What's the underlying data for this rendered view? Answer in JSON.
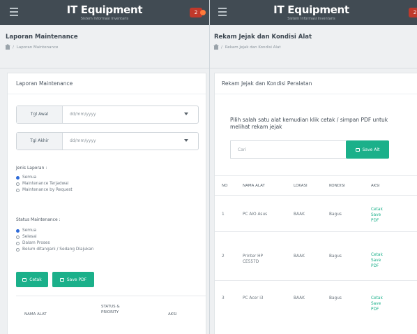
{
  "app": {
    "brand": "IT Equipment",
    "brand_sub": "Sistem Informasi Inventaris",
    "notif_count": "2"
  },
  "left": {
    "page_title": "Laporan Maintenance",
    "breadcrumb": "Laporan Maintenance",
    "card_title": "Laporan Maintenance",
    "tgl_awal_label": "Tgl Awal",
    "tgl_akhir_label": "Tgl Akhir",
    "date_placeholder": "dd/mm/yyyy",
    "jenis_label": "Jenis Laporan :",
    "jenis_options": [
      "Semua",
      "Maintenance Terjadwal",
      "Maintenance by Request"
    ],
    "status_label": "Status Maintenance :",
    "status_options": [
      "Semua",
      "Selesai",
      "Dalam Proses",
      "Belum ditangani / Sedang Diajukan"
    ],
    "btn_cetak": "Cetak",
    "btn_pdf": "Save PDF",
    "table_headers": [
      "NAMA ALAT",
      "STATUS &\nPRIORITY",
      "AKSI"
    ]
  },
  "right": {
    "page_title": "Rekam Jejak dan Kondisi Alat",
    "breadcrumb": "Rekam Jejak dan Kondisi Alat",
    "card_title": "Rekam Jejak dan Kondisi Peralatan",
    "instruction": "Pilih salah satu alat kemudian klik cetak / simpan PDF untuk melihat rekam jejak",
    "search_placeholder": "Cari",
    "btn_save": "Save Alt",
    "table_headers": [
      "NO",
      "NAMA ALAT",
      "LOKASI",
      "KONDISI",
      "AKSI"
    ],
    "rows": [
      {
        "no": "1",
        "nama": "PC AIO Asus",
        "lokasi": "BAAK",
        "kondisi": "Bagus",
        "aksi": [
          "Cetak",
          "Save",
          "PDF"
        ]
      },
      {
        "no": "2",
        "nama": "Printer HP\nCE557D",
        "lokasi": "BAAK",
        "kondisi": "Bagus",
        "aksi": [
          "Cetak",
          "Save",
          "PDF"
        ]
      },
      {
        "no": "3",
        "nama": "PC Acer i3",
        "lokasi": "BAAK",
        "kondisi": "Bagus",
        "aksi": [
          "Cetak",
          "Save",
          "PDF"
        ]
      }
    ]
  },
  "colors": {
    "topbar": "#414b53",
    "accent": "#1bb08a",
    "radio_active": "#2f6bd8",
    "badge": "#c0392b"
  }
}
